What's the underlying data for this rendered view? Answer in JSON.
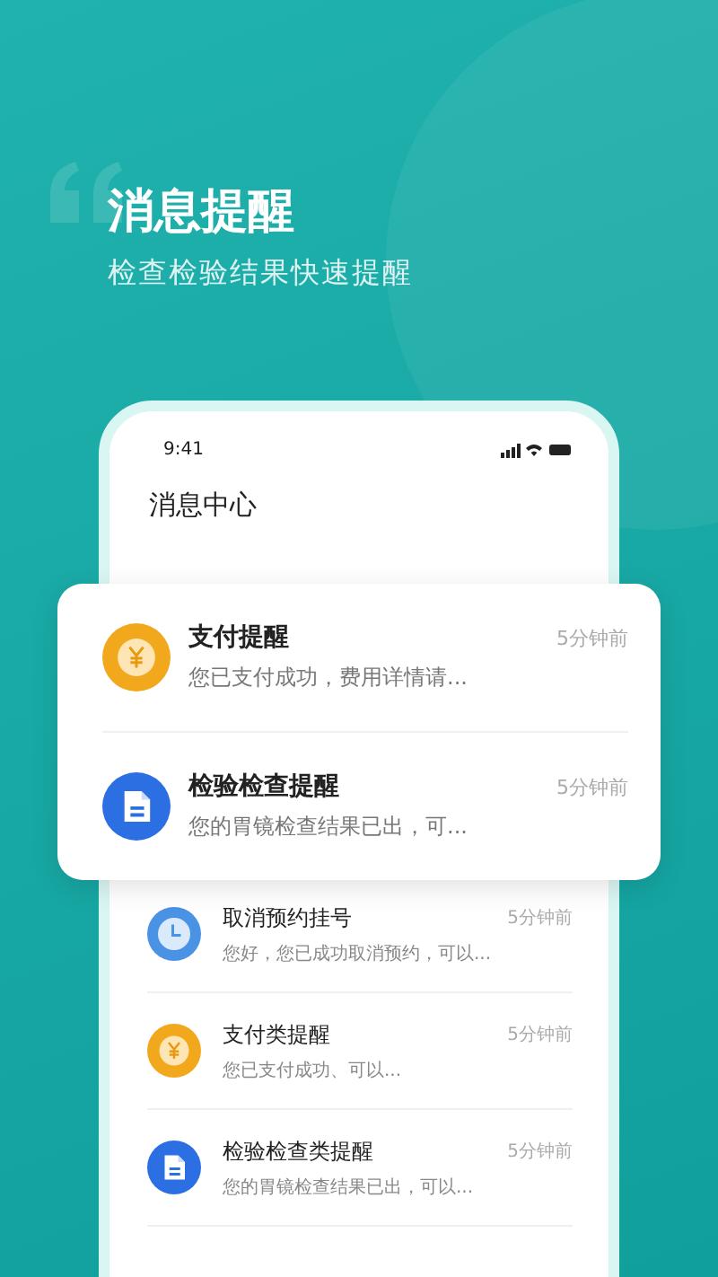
{
  "hero": {
    "title": "消息提醒",
    "subtitle": "检查检验结果快速提醒"
  },
  "phone": {
    "time": "9:41",
    "header": "消息中心",
    "featured": [
      {
        "kind": "payment",
        "title": "支付提醒",
        "time": "5分钟前",
        "text": "您已支付成功，费用详情请..."
      },
      {
        "kind": "report",
        "title": "检验检查提醒",
        "time": "5分钟前",
        "text": "您的胃镜检查结果已出，可..."
      }
    ],
    "items": [
      {
        "kind": "cancel",
        "title": "取消预约挂号",
        "time": "5分钟前",
        "text": "您好，您已成功取消预约，可以..."
      },
      {
        "kind": "payment",
        "title": "支付类提醒",
        "time": "5分钟前",
        "text": "您已支付成功、可以..."
      },
      {
        "kind": "report",
        "title": "检验检查类提醒",
        "time": "5分钟前",
        "text": "您的胃镜检查结果已出，可以..."
      }
    ]
  }
}
